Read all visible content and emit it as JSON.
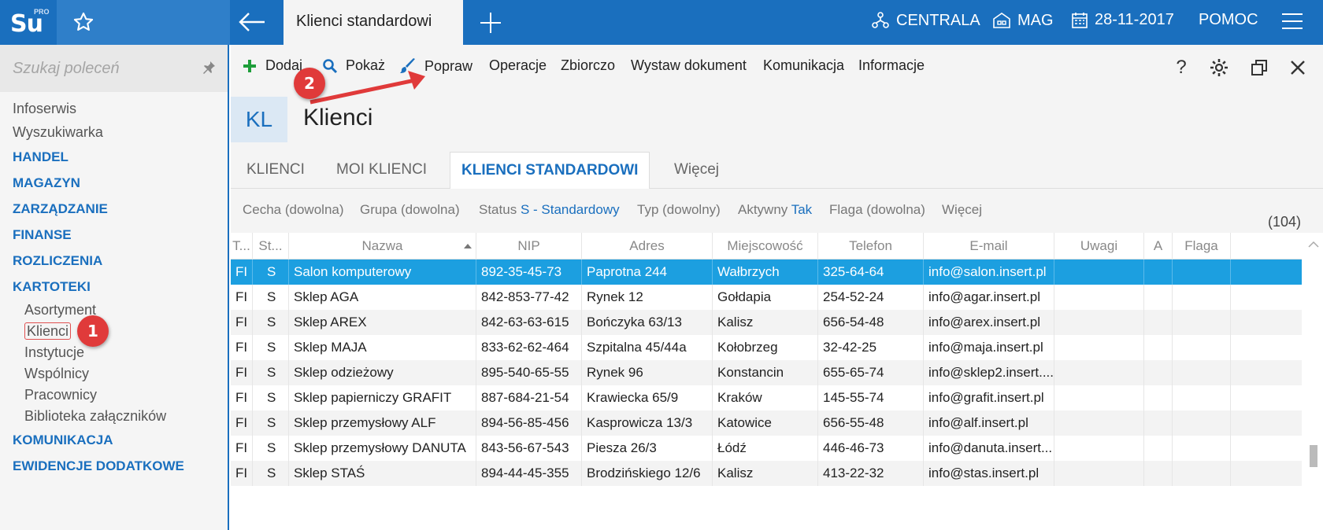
{
  "app": {
    "logo_text": "Su",
    "logo_sup": "PRO"
  },
  "topbar": {
    "tab_title": "Klienci standardowi",
    "centrala": "CENTRALA",
    "mag": "MAG",
    "date": "28-11-2017",
    "help": "POMOC",
    "color": "#1a6fbe"
  },
  "sidebar": {
    "search_placeholder": "Szukaj poleceń",
    "items": [
      {
        "label": "Infoserwis",
        "type": "plain"
      },
      {
        "label": "Wyszukiwarka",
        "type": "plain"
      },
      {
        "label": "HANDEL",
        "type": "head"
      },
      {
        "label": "MAGAZYN",
        "type": "head"
      },
      {
        "label": "ZARZĄDZANIE",
        "type": "head"
      },
      {
        "label": "FINANSE",
        "type": "head"
      },
      {
        "label": "ROZLICZENIA",
        "type": "head"
      },
      {
        "label": "KARTOTEKI",
        "type": "head"
      },
      {
        "label": "Asortyment",
        "type": "sub"
      },
      {
        "label": "Klienci",
        "type": "sub",
        "selected": true
      },
      {
        "label": "Instytucje",
        "type": "sub"
      },
      {
        "label": "Wspólnicy",
        "type": "sub"
      },
      {
        "label": "Pracownicy",
        "type": "sub"
      },
      {
        "label": "Biblioteka załączników",
        "type": "sub"
      },
      {
        "label": "KOMUNIKACJA",
        "type": "head"
      },
      {
        "label": "EWIDENCJE DODATKOWE",
        "type": "head"
      }
    ]
  },
  "annotations": {
    "badge1": "1",
    "badge2": "2"
  },
  "toolbar": {
    "dodaj": "Dodaj",
    "pokaz": "Pokaż",
    "popraw": "Popraw",
    "operacje": "Operacje",
    "zbiorczo": "Zbiorczo",
    "wystaw": "Wystaw dokument",
    "komunikacja": "Komunikacja",
    "informacje": "Informacje",
    "help": "?"
  },
  "header": {
    "code": "KL",
    "title": "Klienci"
  },
  "tabs": {
    "t1": "KLIENCI",
    "t2": "MOI KLIENCI",
    "t3": "KLIENCI STANDARDOWI",
    "more": "Więcej"
  },
  "filters": {
    "cecha": "Cecha (dowolna)",
    "grupa": "Grupa (dowolna)",
    "status_label": "Status",
    "status_value": "S - Standardowy",
    "typ": "Typ (dowolny)",
    "aktywny_label": "Aktywny",
    "aktywny_value": "Tak",
    "flaga": "Flaga (dowolna)",
    "more": "Więcej",
    "count": "(104)"
  },
  "table": {
    "columns": [
      "T...",
      "St...",
      "Nazwa",
      "NIP",
      "Adres",
      "Miejscowość",
      "Telefon",
      "E-mail",
      "Uwagi",
      "A",
      "Flaga"
    ],
    "rows": [
      [
        "FI",
        "S",
        "Salon komputerowy",
        "892-35-45-73",
        "Paprotna  244",
        "Wałbrzych",
        "325-64-64",
        "info@salon.insert.pl",
        "",
        "",
        ""
      ],
      [
        "FI",
        "S",
        "Sklep AGA",
        "842-853-77-42",
        "Rynek 12",
        "Gołdapia",
        "254-52-24",
        "info@agar.insert.pl",
        "",
        "",
        ""
      ],
      [
        "FI",
        "S",
        "Sklep AREX",
        "842-63-63-615",
        "Bończyka  63/13",
        "Kalisz",
        "656-54-48",
        "info@arex.insert.pl",
        "",
        "",
        ""
      ],
      [
        "FI",
        "S",
        "Sklep MAJA",
        "833-62-62-464",
        "Szpitalna  45/44a",
        "Kołobrzeg",
        "32-42-25",
        "info@maja.insert.pl",
        "",
        "",
        ""
      ],
      [
        "FI",
        "S",
        "Sklep odzieżowy",
        "895-540-65-55",
        "Rynek  96",
        "Konstancin",
        "655-65-74",
        "info@sklep2.insert....",
        "",
        "",
        ""
      ],
      [
        "FI",
        "S",
        "Sklep papierniczy GRAFIT",
        "887-684-21-54",
        "Krawiecka  65/9",
        "Kraków",
        "145-55-74",
        "info@grafit.insert.pl",
        "",
        "",
        ""
      ],
      [
        "FI",
        "S",
        "Sklep przemysłowy ALF",
        "894-56-85-456",
        "Kasprowicza  13/3",
        "Katowice",
        "656-55-48",
        "info@alf.insert.pl",
        "",
        "",
        ""
      ],
      [
        "FI",
        "S",
        "Sklep przemysłowy DANUTA",
        "843-56-67-543",
        "Piesza  26/3",
        "Łódź",
        "446-46-73",
        "info@danuta.insert...",
        "",
        "",
        ""
      ],
      [
        "FI",
        "S",
        "Sklep STAŚ",
        "894-44-45-355",
        "Brodzińskiego  12/6",
        "Kalisz",
        "413-22-32",
        "info@stas.insert.pl",
        "",
        "",
        ""
      ]
    ],
    "selected_row": 0,
    "selected_color": "#1c9fe0"
  }
}
